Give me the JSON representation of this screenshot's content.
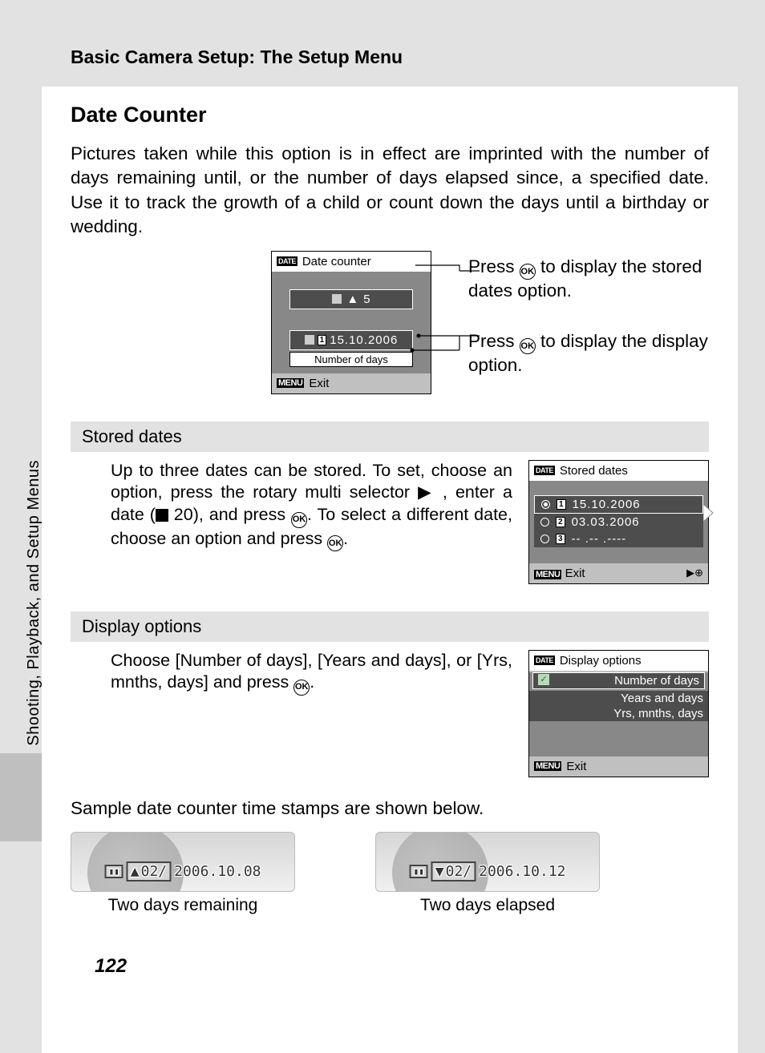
{
  "header": "Basic Camera Setup: The Setup Menu",
  "title": "Date Counter",
  "intro": "Pictures taken while this option is in effect are imprinted with the number of days remaining until, or the number of days elapsed since, a specified date. Use it to track the growth of a child or count down the days until a birthday or wedding.",
  "lcd1": {
    "title": "Date counter",
    "count": "5",
    "date": "15.10.2006",
    "sub": "Number of days",
    "exit": "Exit"
  },
  "callout1": "Press      to display the stored dates option.",
  "callout2": "Press      to display the display option.",
  "stored": {
    "heading": "Stored dates",
    "text_a": "Up to three dates can be stored. To set, choose an option, press the rotary multi selector ",
    "text_b": " , enter a date (",
    "text_c": " 20), and press ",
    "text_d": ". To select a different date, choose an option and press ",
    "text_e": "."
  },
  "lcd2": {
    "title": "Stored dates",
    "d1": "15.10.2006",
    "d2": "03.03.2006",
    "d3": "-- .-- .----",
    "exit": "Exit"
  },
  "display": {
    "heading": "Display options",
    "text_a": "Choose [Number of days], [Years and days], or [Yrs, mnths, days] and press ",
    "text_b": "."
  },
  "lcd3": {
    "title": "Display options",
    "o1": "Number of days",
    "o2": "Years and days",
    "o3": "Yrs, mnths, days",
    "exit": "Exit"
  },
  "sample_intro": "Sample date counter time stamps are shown below.",
  "s1": {
    "count": "02/",
    "date": "2006.10.08",
    "caption": "Two days remaining"
  },
  "s2": {
    "count": "02/",
    "date": "2006.10.12",
    "caption": "Two days elapsed"
  },
  "side": "Shooting, Playback, and Setup Menus",
  "page": "122"
}
